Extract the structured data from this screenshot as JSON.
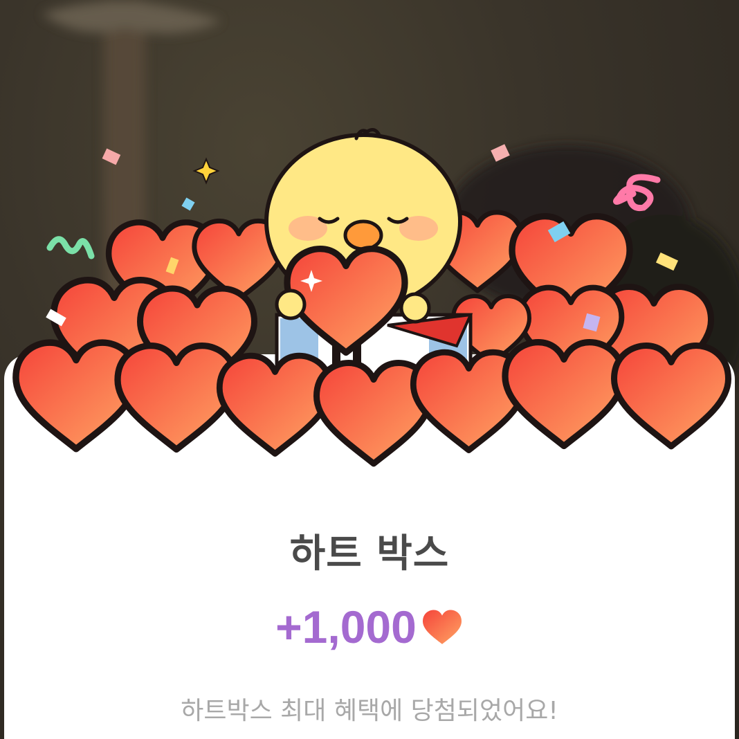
{
  "popup": {
    "title": "하트 박스",
    "reward_amount": "+1,000",
    "reward_icon": "heart-icon",
    "description": "하트박스 최대 혜택에 당첨되었어요!"
  },
  "colors": {
    "reward_purple": "#a46ad0",
    "heart_red": "#f5543c",
    "heart_orange": "#ff9a5a",
    "title_gray": "#4a4a4a",
    "desc_gray": "#a8a8a8",
    "sheet_bg": "#ffffff"
  }
}
